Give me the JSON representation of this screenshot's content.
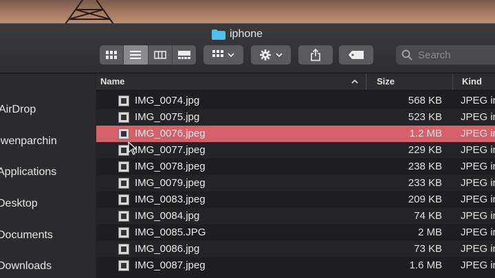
{
  "window": {
    "title": "iphone"
  },
  "toolbar": {
    "view_buttons": [
      "icon-view",
      "list-view",
      "column-view",
      "gallery-view"
    ],
    "search_placeholder": "Search"
  },
  "sidebar": {
    "items": [
      {
        "label": "AirDrop"
      },
      {
        "label": "owenparchin"
      },
      {
        "label": "Applications"
      },
      {
        "label": "Desktop"
      },
      {
        "label": "Documents"
      },
      {
        "label": "Downloads"
      }
    ]
  },
  "columns": {
    "name": "Name",
    "size": "Size",
    "kind": "Kind"
  },
  "files": [
    {
      "name": "IMG_0074.jpg",
      "size": "568 KB",
      "kind": "JPEG in"
    },
    {
      "name": "IMG_0075.jpg",
      "size": "523 KB",
      "kind": "JPEG in"
    },
    {
      "name": "IMG_0076.jpeg",
      "size": "1.2 MB",
      "kind": "JPEG in",
      "selected": true
    },
    {
      "name": "IMG_0077.jpeg",
      "size": "229 KB",
      "kind": "JPEG in"
    },
    {
      "name": "IMG_0078.jpeg",
      "size": "238 KB",
      "kind": "JPEG in"
    },
    {
      "name": "IMG_0079.jpeg",
      "size": "233 KB",
      "kind": "JPEG in"
    },
    {
      "name": "IMG_0083.jpeg",
      "size": "209 KB",
      "kind": "JPEG in"
    },
    {
      "name": "IMG_0084.jpg",
      "size": "74 KB",
      "kind": "JPEG in"
    },
    {
      "name": "IMG_0085.JPG",
      "size": "2 MB",
      "kind": "JPEG in"
    },
    {
      "name": "IMG_0086.jpg",
      "size": "73 KB",
      "kind": "JPEG in"
    },
    {
      "name": "IMG_0087.jpeg",
      "size": "1.6 MB",
      "kind": "JPEG in"
    }
  ],
  "colors": {
    "selection": "#d4606a",
    "folder": "#4cc0e8"
  }
}
